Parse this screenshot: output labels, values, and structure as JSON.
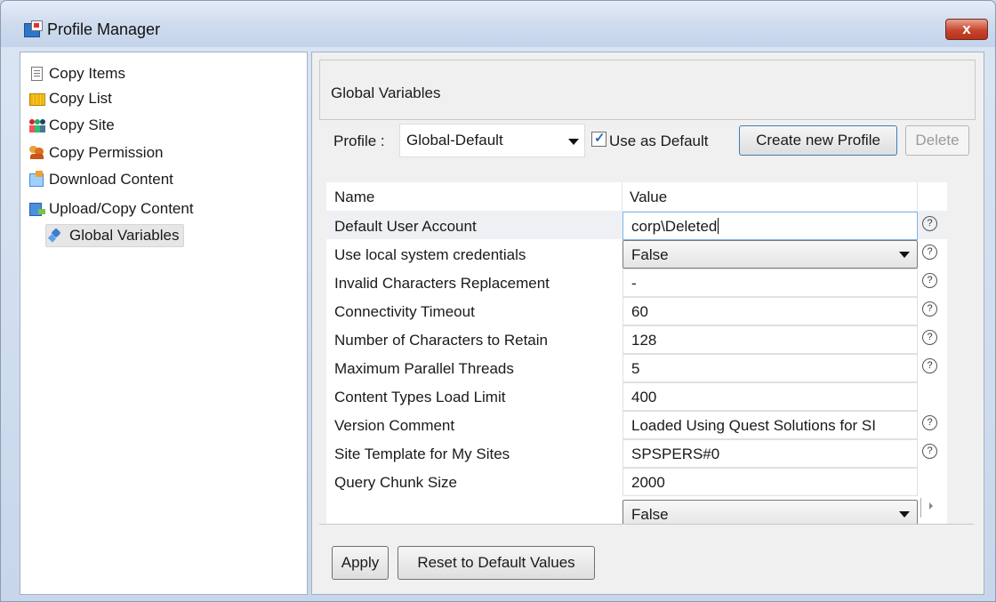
{
  "window": {
    "title": "Profile Manager",
    "close_label": "x"
  },
  "sidebar": {
    "items": [
      {
        "label": "Copy Items",
        "icon": "document-icon"
      },
      {
        "label": "Copy List",
        "icon": "list-icon"
      },
      {
        "label": "Copy Site",
        "icon": "site-icon"
      },
      {
        "label": "Copy Permission",
        "icon": "users-icon"
      },
      {
        "label": "Download Content",
        "icon": "download-icon"
      },
      {
        "label": "Upload/Copy Content",
        "icon": "upload-icon"
      },
      {
        "label": "Global Variables",
        "icon": "diamond-icon",
        "selected": true
      }
    ]
  },
  "panel": {
    "title": "Global Variables",
    "profile_label": "Profile :",
    "profile_value": "Global-Default",
    "use_as_default_label": "Use as Default",
    "use_as_default_checked": true,
    "create_button": "Create new Profile",
    "delete_button": "Delete",
    "apply_button": "Apply",
    "reset_button": "Reset to Default Values",
    "grid": {
      "columns": [
        "Name",
        "Value"
      ],
      "rows": [
        {
          "name": "Default User Account",
          "value": "corp\\Deleted",
          "help": true,
          "type": "text-focused"
        },
        {
          "name": "Use local system credentials",
          "value": "False",
          "help": true,
          "type": "combo"
        },
        {
          "name": "Invalid Characters Replacement",
          "value": "-",
          "help": true,
          "type": "text"
        },
        {
          "name": "Connectivity Timeout",
          "value": "60",
          "help": true,
          "type": "text"
        },
        {
          "name": "Number of Characters to Retain",
          "value": "128",
          "help": true,
          "type": "text"
        },
        {
          "name": "Maximum Parallel Threads",
          "value": "5",
          "help": true,
          "type": "text"
        },
        {
          "name": "Content Types Load Limit",
          "value": "400",
          "help": false,
          "type": "text"
        },
        {
          "name": "Version Comment",
          "value": "Loaded Using Quest Solutions for SI",
          "help": true,
          "type": "text"
        },
        {
          "name": "Site Template for My Sites",
          "value": "SPSPERS#0",
          "help": true,
          "type": "text"
        },
        {
          "name": "Query Chunk Size",
          "value": "2000",
          "help": false,
          "type": "text"
        },
        {
          "name": "",
          "value": "False",
          "help": false,
          "type": "combo"
        }
      ]
    },
    "help_glyph": "?"
  },
  "colors": {
    "close_button": "#c7452e",
    "focus_border": "#7eb4ea",
    "checkbox_mark": "#2d6bb3"
  }
}
